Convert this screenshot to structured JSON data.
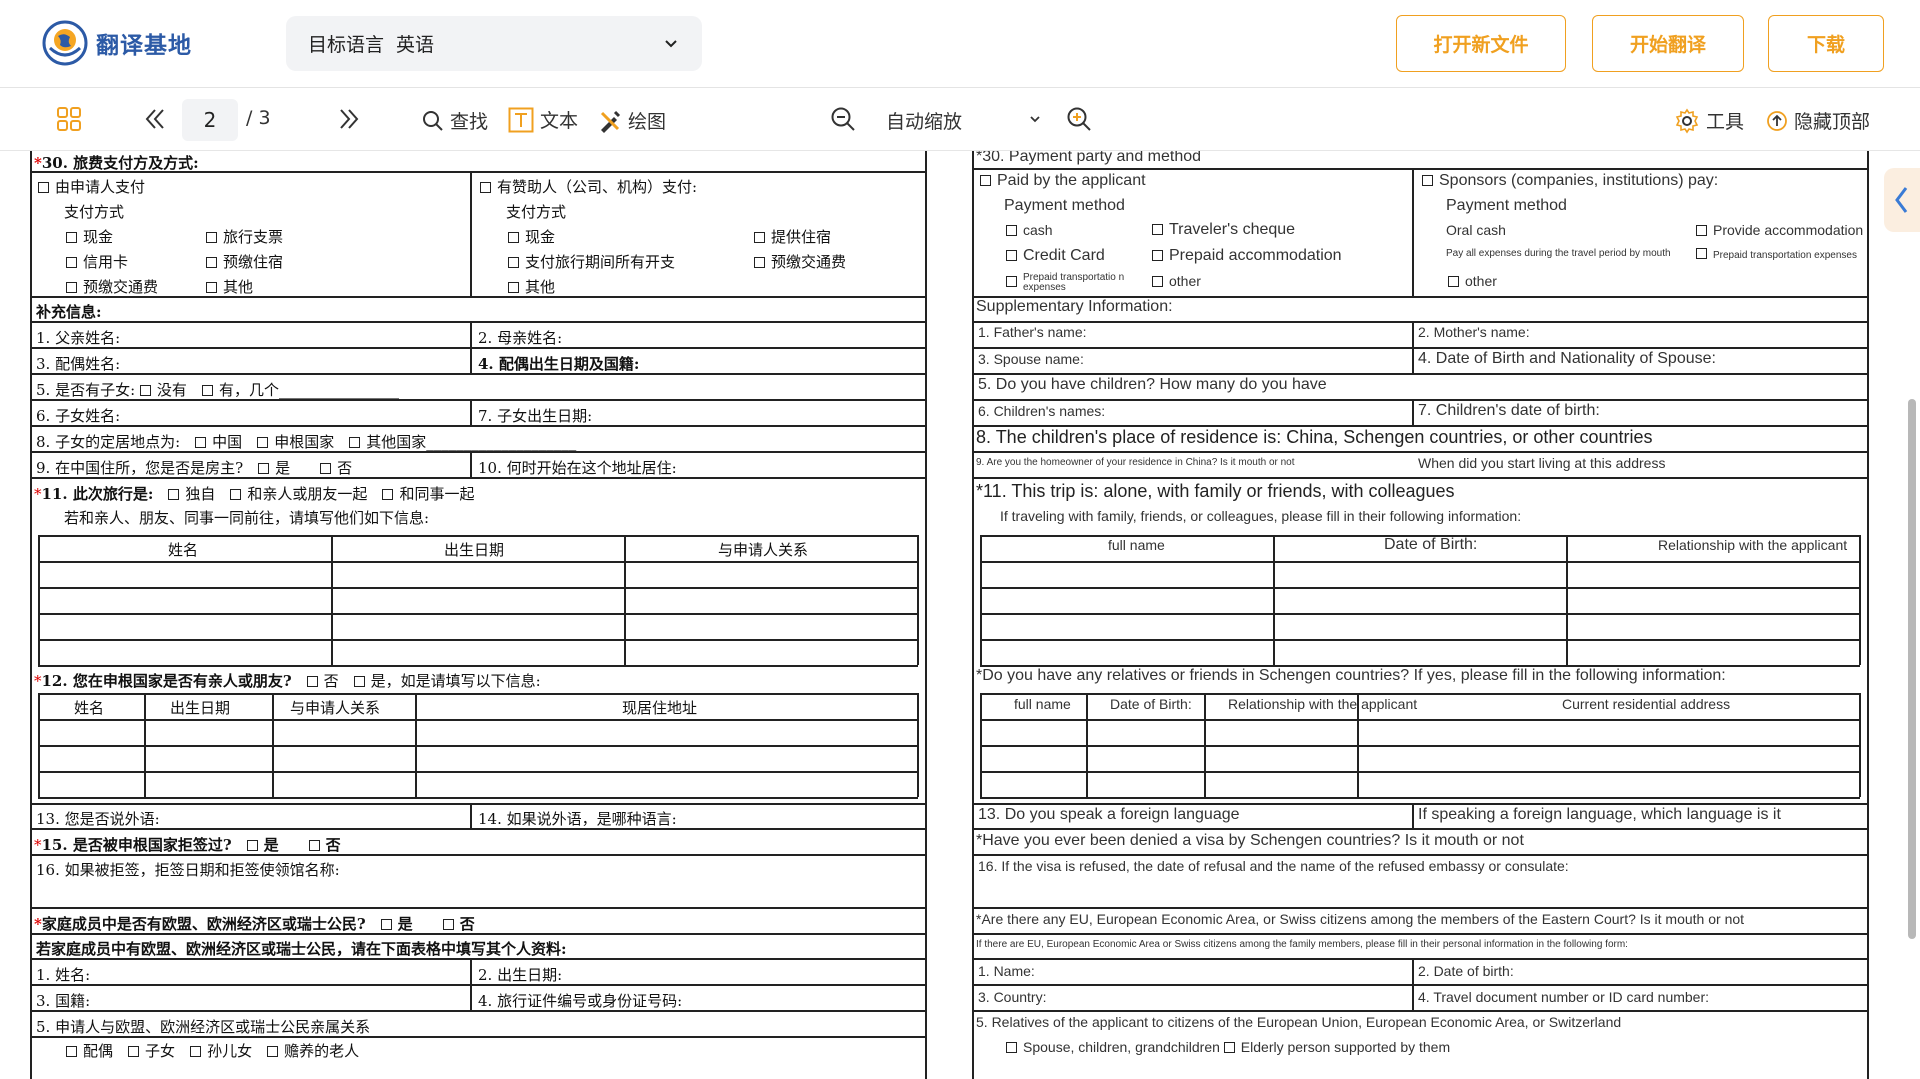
{
  "app": {
    "name": "翻译基地"
  },
  "header": {
    "lang_label": "目标语言",
    "lang_value": "英语",
    "btn_open": "打开新文件",
    "btn_translate": "开始翻译",
    "btn_download": "下载",
    "accent": "#f0a020"
  },
  "toolbar": {
    "page_current": "2",
    "page_total": "/ 3",
    "find": "查找",
    "text": "文本",
    "draw": "绘图",
    "zoom": "自动缩放",
    "tools": "工具",
    "hide_top": "隐藏顶部"
  },
  "left": {
    "r30": "30. 旅费支付方及方式:",
    "self_pay": "由申请人支付",
    "pay_method": "支付方式",
    "cash": "现金",
    "cheque": "旅行支票",
    "credit": "信用卡",
    "prepaid_acc": "预缴住宿",
    "prepaid_trans": "预缴交通费",
    "other": "其他",
    "sponsor": "有赞助人（公司、机构）支付:",
    "pay_method2": "支付方式",
    "cash2": "现金",
    "provide_acc": "提供住宿",
    "all_exp": "支付旅行期间所有开支",
    "prepaid_trans2": "预缴交通费",
    "other2": "其他",
    "supp": "补充信息:",
    "f1": "1. 父亲姓名:",
    "f2": "2. 母亲姓名:",
    "f3": "3. 配偶姓名:",
    "f4": "4. 配偶出生日期及国籍:",
    "f5": "5. 是否有子女:",
    "f5a": "没有",
    "f5b": "有，几个",
    "f6": "6. 子女姓名:",
    "f7": "7. 子女出生日期:",
    "f8": "8. 子女的定居地点为:",
    "f8a": "中国",
    "f8b": "申根国家",
    "f8c": "其他国家",
    "f9": "9. 在中国住所，您是否是房主?",
    "f9a": "是",
    "f9b": "否",
    "f10": "10. 何时开始在这个地址居住:",
    "r11": "11. 此次旅行是:",
    "r11a": "独自",
    "r11b": "和亲人或朋友一起",
    "r11c": "和同事一起",
    "r11note": "若和亲人、朋友、同事一同前往，请填写他们如下信息:",
    "t1h": [
      "姓名",
      "出生日期",
      "与申请人关系"
    ],
    "r12": "12. 您在申根国家是否有亲人或朋友?",
    "r12a": "否",
    "r12b": "是，如是请填写以下信息:",
    "t2h": [
      "姓名",
      "出生日期",
      "与申请人关系",
      "现居住地址"
    ],
    "f13": "13. 您是否说外语:",
    "f14": "14. 如果说外语，是哪种语言:",
    "r15": "15. 是否被申根国家拒签过?",
    "r15a": "是",
    "r15b": "否",
    "f16": "16. 如果被拒签，拒签日期和拒签使领馆名称:",
    "eu1": "家庭成员中是否有欧盟、欧洲经济区或瑞士公民?",
    "eu1a": "是",
    "eu1b": "否",
    "eu2": "若家庭成员中有欧盟、欧洲经济区或瑞士公民，请在下面表格中填写其个人资料:",
    "e1": "1. 姓名:",
    "e2": "2. 出生日期:",
    "e3": "3. 国籍:",
    "e4": "4. 旅行证件编号或身份证号码:",
    "e5": "5. 申请人与欧盟、欧洲经济区或瑞士公民亲属关系",
    "e5a": "配偶",
    "e5b": "子女",
    "e5c": "孙儿女",
    "e5d": "赡养的老人"
  },
  "right": {
    "r30": "*30. Payment party and method",
    "self_pay": "Paid by the applicant",
    "pay_method": "Payment method",
    "cash": "cash",
    "cheque": "Traveler's cheque",
    "credit": "Credit Card",
    "prepaid_acc": "Prepaid accommodation",
    "prepaid_trans": "Prepaid transportatio n expenses",
    "other": "other",
    "sponsor": "Sponsors (companies, institutions) pay:",
    "pay_method2": "Payment method",
    "oral_cash": "Oral cash",
    "provide_acc": "Provide accommodation",
    "all_exp": "Pay all expenses during the travel period by mouth",
    "prepaid_trans2": "Prepaid transportation expenses",
    "other2": "other",
    "supp": "Supplementary Information:",
    "f1": "1. Father's name:",
    "f2": "2. Mother's name:",
    "f3": "3. Spouse name:",
    "f4": "4. Date of Birth and Nationality of Spouse:",
    "f5": "5. Do you have children? How many do you have",
    "f6": "6. Children's names:",
    "f7": "7. Children's date of birth:",
    "f8": "8. The children's place of residence is: China, Schengen countries, or other countries",
    "f9": "9. Are you the homeowner of your residence in China? Is it mouth or not",
    "f10": "When did you start living at this address",
    "r11": "*11. This trip is: alone, with family or friends, with colleagues",
    "r11note": "If traveling with family, friends, or colleagues, please fill in their following information:",
    "t1h": [
      "full name",
      "Date of Birth:",
      "Relationship with the applicant"
    ],
    "r12": "*Do you have any relatives or friends in Schengen countries? If yes, please fill in the following information:",
    "t2h": [
      "full name",
      "Date of Birth:",
      "Relationship with the applicant",
      "Current residential address"
    ],
    "f13": "13. Do you speak a foreign language",
    "f14": "If speaking a foreign language, which language is it",
    "r15": "*Have you ever been denied a visa by Schengen countries? Is it mouth or not",
    "f16": "16. If the visa is refused, the date of refusal and the name of the refused embassy or consulate:",
    "eu1": "*Are there any EU, European Economic Area, or Swiss citizens among the members of the Eastern Court? Is it mouth or not",
    "eu2": "If there are EU, European Economic Area or Swiss citizens among the family members, please fill in their personal information in the following form:",
    "e1": "1. Name:",
    "e2": "2. Date of birth:",
    "e3": "3. Country:",
    "e4": "4. Travel document number or ID card number:",
    "e5": "5. Relatives of the applicant to citizens of the European Union, European Economic Area, or Switzerland",
    "e5a": "Spouse, children, grandchildren",
    "e5b": "Elderly person supported by them"
  }
}
